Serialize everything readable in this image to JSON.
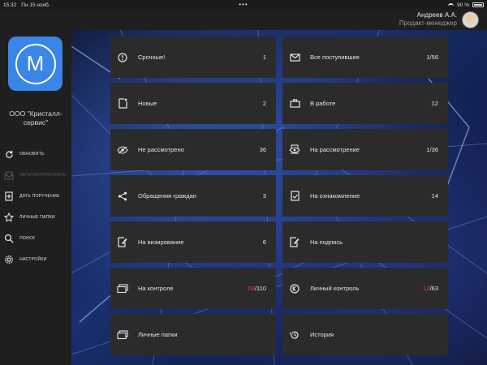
{
  "statusbar": {
    "time": "15:32",
    "date": "Пн 15 нояб.",
    "dots": "•••",
    "battery": "90 %"
  },
  "user": {
    "name": "Андреев А.А.",
    "role": "Продакт-менеджер"
  },
  "org": {
    "logo_letter": "М",
    "name": "ООО \"Кристалл-сервис\""
  },
  "menu": [
    {
      "label": "обновить",
      "icon": "refresh-icon",
      "enabled": true
    },
    {
      "label": "Зарегистрировать",
      "icon": "inbox-icon",
      "enabled": false
    },
    {
      "label": "Дать поручение",
      "icon": "document-plus-icon",
      "enabled": true
    },
    {
      "label": "Личные папки",
      "icon": "star-icon",
      "enabled": true
    },
    {
      "label": "Поиск",
      "icon": "search-icon",
      "enabled": true
    },
    {
      "label": "Настройки",
      "icon": "gear-icon",
      "enabled": true
    }
  ],
  "tiles_left": [
    {
      "label": "Срочные!",
      "count": "1",
      "icon": "alert-circle-icon"
    },
    {
      "label": "Новые",
      "count": "2",
      "icon": "new-document-icon"
    },
    {
      "label": "Не рассмотрено",
      "count": "36",
      "icon": "eye-off-icon"
    },
    {
      "label": "Обращения граждан",
      "count": "3",
      "icon": "share-icon"
    },
    {
      "label": "На визирование",
      "count": "6",
      "icon": "sign-document-icon"
    },
    {
      "label": "На контроле",
      "count_highlight": "59",
      "count_rest": "/110",
      "icon": "folders-icon"
    },
    {
      "label": "Личные папки",
      "count": "",
      "icon": "folders-icon"
    }
  ],
  "tiles_right": [
    {
      "label": "Все поступившие",
      "count": "1/56",
      "icon": "envelope-icon"
    },
    {
      "label": "В работе",
      "count": "12",
      "icon": "briefcase-icon"
    },
    {
      "label": "На рассмотрение",
      "count": "1/36",
      "icon": "review-icon"
    },
    {
      "label": "На ознакомление",
      "count": "14",
      "icon": "checked-document-icon"
    },
    {
      "label": "На подпись",
      "count": "",
      "icon": "sign-document-icon"
    },
    {
      "label": "Личный контроль",
      "count_highlight": "12",
      "count_rest": "/63",
      "icon": "k-circle-icon"
    },
    {
      "label": "История",
      "count": "",
      "icon": "history-icon"
    }
  ],
  "colors": {
    "accent": "#3a86e8",
    "highlight": "#e33b3b",
    "tile": "#2b2b2b",
    "panel": "#1f1f1f"
  }
}
